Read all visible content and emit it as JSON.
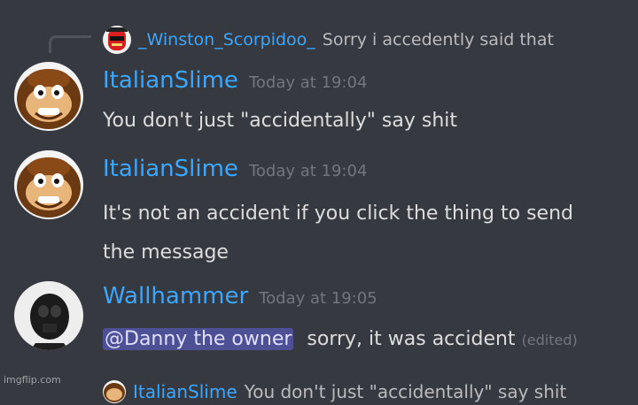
{
  "reply": {
    "author": "_Winston_Scorpidoo_",
    "text": "Sorry i accedently said that"
  },
  "messages": [
    {
      "author": "ItalianSlime",
      "timestamp": "Today at 19:04",
      "lines": [
        "You don't just \"accidentally\" say shit"
      ]
    },
    {
      "author": "ItalianSlime",
      "timestamp": "Today at 19:04",
      "lines": [
        "It's not an accident if you click the thing to send",
        "the message"
      ]
    },
    {
      "author": "Wallhammer",
      "timestamp": "Today at 19:05",
      "mention": "@Danny the owner",
      "text": "sorry, it was accident",
      "edited": "(edited)"
    }
  ],
  "bottom_reply": {
    "author": "ItalianSlime",
    "text": "You don't just \"accidentally\" say shit"
  },
  "watermark": "imgflip.com",
  "colors": {
    "background": "#36393f",
    "username": "#3ba7ff",
    "timestamp": "#72767d",
    "mention_bg": "#4e5096"
  },
  "icons": {
    "avatar_italianslime": "donkey-kong-avatar",
    "avatar_wallhammer": "stormtrooper-avatar",
    "avatar_winston": "red-mask-avatar"
  }
}
